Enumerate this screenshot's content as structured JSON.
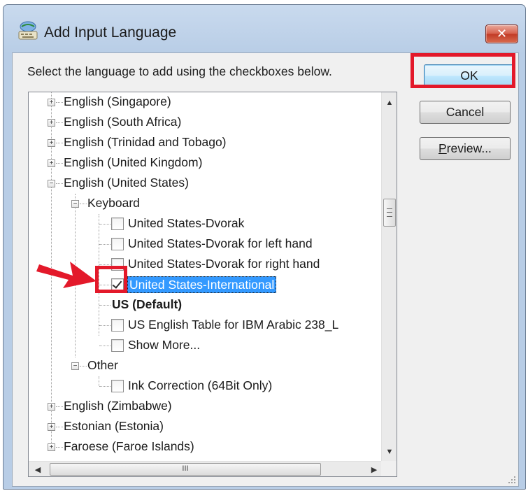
{
  "window": {
    "title": "Add Input Language",
    "close_symbol": "✕"
  },
  "instruction": "Select the language to add using the checkboxes below.",
  "buttons": {
    "ok": "OK",
    "cancel": "Cancel",
    "preview_prefix": "P",
    "preview_rest": "review..."
  },
  "tree": {
    "english_singapore": "English (Singapore)",
    "english_south_africa": "English (South Africa)",
    "english_trinidad": "English (Trinidad and Tobago)",
    "english_uk": "English (United Kingdom)",
    "english_us": "English (United States)",
    "keyboard": "Keyboard",
    "us_dvorak": "United States-Dvorak",
    "us_dvorak_left": "United States-Dvorak for left hand",
    "us_dvorak_right": "United States-Dvorak for right hand",
    "us_international": "United States-International",
    "us_default": "US (Default)",
    "us_english_ibm_arabic": "US English Table for IBM Arabic 238_L",
    "show_more": "Show More...",
    "other": "Other",
    "ink_correction": "Ink Correction (64Bit Only)",
    "english_zimbabwe": "English (Zimbabwe)",
    "estonian": "Estonian (Estonia)",
    "faroese": "Faroese (Faroe Islands)"
  },
  "checkbox_state": {
    "us_international": true
  },
  "scrollbar": {
    "h_thumb_grip": "III"
  },
  "colors": {
    "highlight_red": "#e3192a",
    "selection_blue": "#3399ff"
  }
}
